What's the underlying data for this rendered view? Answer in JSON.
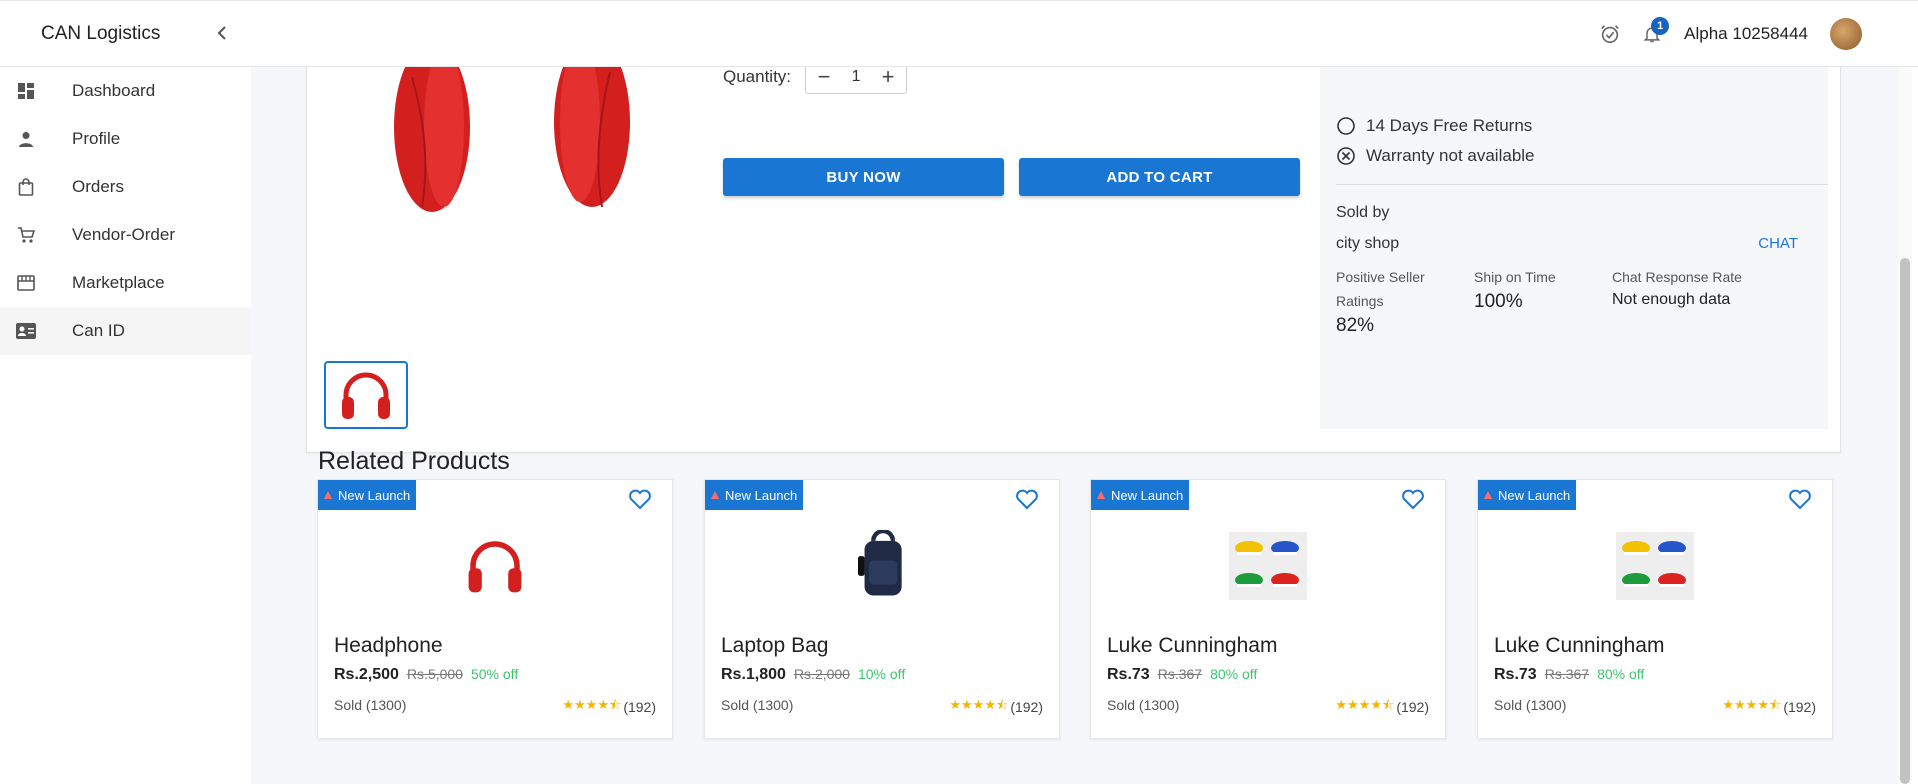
{
  "app": {
    "title": "CAN Logistics"
  },
  "header": {
    "user_name": "Alpha 10258444",
    "notification_count": "1",
    "icons": [
      "alarm-icon",
      "bell-icon"
    ]
  },
  "sidebar": {
    "items": [
      {
        "label": "Dashboard",
        "icon": "dashboard-icon",
        "active": false
      },
      {
        "label": "Profile",
        "icon": "person-icon",
        "active": false
      },
      {
        "label": "Orders",
        "icon": "shopping-bag-icon",
        "active": false
      },
      {
        "label": "Vendor-Order",
        "icon": "cart-icon",
        "active": false
      },
      {
        "label": "Marketplace",
        "icon": "storefront-icon",
        "active": false
      },
      {
        "label": "Can ID",
        "icon": "id-card-icon",
        "active": true
      }
    ]
  },
  "product": {
    "quantity_label": "Quantity:",
    "quantity_value": "1",
    "buy_now": "BUY NOW",
    "add_to_cart": "ADD TO CART"
  },
  "seller": {
    "returns_text": "14 Days Free Returns",
    "warranty_text": "Warranty not available",
    "sold_by_label": "Sold by",
    "shop_name": "city shop",
    "chat_label": "CHAT",
    "stats": [
      {
        "label": "Positive Seller Ratings",
        "value": "82%"
      },
      {
        "label": "Ship on Time",
        "value": "100%"
      },
      {
        "label": "Chat Response Rate",
        "value": "Not enough data"
      }
    ]
  },
  "related": {
    "title": "Related Products",
    "products": [
      {
        "badge": "New Launch",
        "name": "Headphone",
        "price": "Rs.2,500",
        "mrp": "Rs.5,000",
        "discount": "50% off",
        "sold": "Sold (1300)",
        "rating_count": "(192)",
        "rating": 4.5,
        "image": "headphone"
      },
      {
        "badge": "New Launch",
        "name": "Laptop Bag",
        "price": "Rs.1,800",
        "mrp": "Rs.2,000",
        "discount": "10% off",
        "sold": "Sold (1300)",
        "rating_count": "(192)",
        "rating": 4.5,
        "image": "bag"
      },
      {
        "badge": "New Launch",
        "name": "Luke Cunningham",
        "price": "Rs.73",
        "mrp": "Rs.367",
        "discount": "80% off",
        "sold": "Sold (1300)",
        "rating_count": "(192)",
        "rating": 4.5,
        "image": "shoes"
      },
      {
        "badge": "New Launch",
        "name": "Luke Cunningham",
        "price": "Rs.73",
        "mrp": "Rs.367",
        "discount": "80% off",
        "sold": "Sold (1300)",
        "rating_count": "(192)",
        "rating": 4.5,
        "image": "shoes"
      }
    ]
  },
  "colors": {
    "primary": "#1976d2",
    "discount": "#3cc46b",
    "star": "#f4b400"
  }
}
